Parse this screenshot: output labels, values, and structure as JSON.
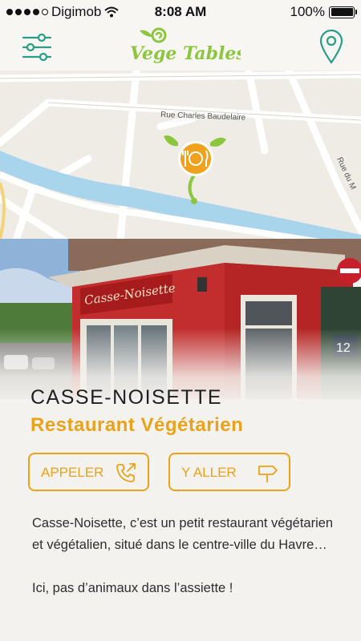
{
  "status_bar": {
    "carrier": "Digimob",
    "time": "8:08 AM",
    "battery": "100%"
  },
  "header": {
    "logo_text": "Vege Tables",
    "icons": {
      "left": "sliders-filter-icon",
      "right": "map-pin-icon"
    }
  },
  "map": {
    "streets": [
      "Rue Charles Baudelaire",
      "Rue du M"
    ],
    "marker_icon": "fork-plate-knife-icon"
  },
  "photo": {
    "sign_text": "Casse-Noisette",
    "sign_number": "12"
  },
  "restaurant": {
    "name": "CASSE-NOISETTE",
    "type": "Restaurant Végétarien"
  },
  "actions": {
    "call_label": "APPELER",
    "go_label": "Y ALLER"
  },
  "description": {
    "paragraph1": "Casse-Noisette, c’est un petit restaurant végétarien et végétalien, situé dans le centre-ville du Havre…",
    "paragraph2": "Ici, pas d’animaux dans l’assiette !"
  },
  "colors": {
    "accent_orange": "#e9a21a",
    "accent_green": "#8cc63f",
    "teal": "#2a9d87",
    "river": "#a8d4ec"
  }
}
